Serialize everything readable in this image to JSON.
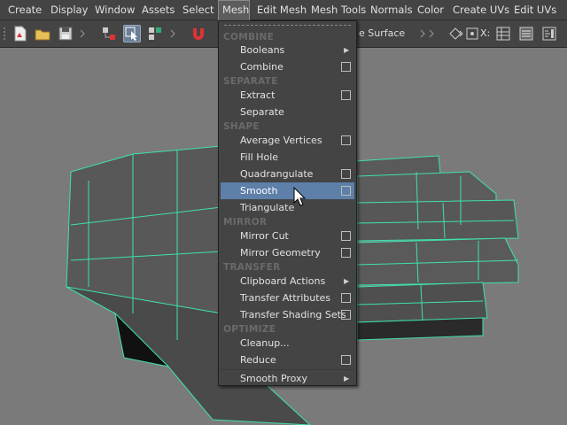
{
  "menubar": {
    "items": [
      {
        "label": "Create"
      },
      {
        "label": "Display"
      },
      {
        "label": "Window"
      },
      {
        "label": "Assets"
      },
      {
        "label": "Select"
      },
      {
        "label": "Mesh",
        "active": true
      },
      {
        "label": "Edit Mesh"
      },
      {
        "label": "Mesh Tools"
      },
      {
        "label": "Normals"
      },
      {
        "label": "Color"
      },
      {
        "label": "Create UVs"
      },
      {
        "label": "Edit UVs"
      }
    ]
  },
  "toolbar": {
    "field_text": "e Surface",
    "x_label": "X:"
  },
  "mesh_menu": {
    "sections": [
      {
        "title": "COMBINE"
      },
      {
        "title": "SEPARATE"
      },
      {
        "title": "SHAPE"
      },
      {
        "title": "MIRROR"
      },
      {
        "title": "TRANSFER"
      },
      {
        "title": "OPTIMIZE"
      }
    ],
    "items": [
      {
        "label": "Booleans",
        "submenu": true
      },
      {
        "label": "Combine",
        "option_box": true
      },
      {
        "label": "Extract",
        "option_box": true
      },
      {
        "label": "Separate"
      },
      {
        "label": "Average Vertices",
        "option_box": true
      },
      {
        "label": "Fill Hole"
      },
      {
        "label": "Quadrangulate",
        "option_box": true
      },
      {
        "label": "Smooth",
        "option_box": true,
        "highlighted": true
      },
      {
        "label": "Triangulate"
      },
      {
        "label": "Mirror Cut",
        "option_box": true
      },
      {
        "label": "Mirror Geometry",
        "option_box": true
      },
      {
        "label": "Clipboard Actions",
        "submenu": true
      },
      {
        "label": "Transfer Attributes",
        "option_box": true
      },
      {
        "label": "Transfer Shading Sets",
        "option_box": true
      },
      {
        "label": "Cleanup..."
      },
      {
        "label": "Reduce",
        "option_box": true
      },
      {
        "label": "Smooth Proxy",
        "submenu": true
      }
    ]
  },
  "colors": {
    "highlight": "#5d7fa8",
    "wireframe": "#3fe0b0",
    "ui_bg": "#444444",
    "viewport_bg": "#7a7a7a"
  },
  "icons": {
    "submenu": "chevron-right-icon",
    "option": "option-box-icon"
  }
}
